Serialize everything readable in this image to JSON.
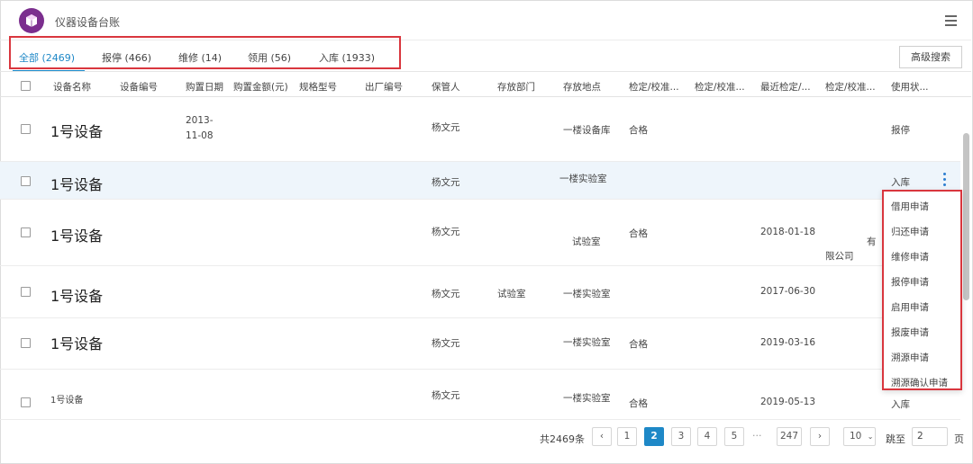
{
  "app": {
    "title": "仪器设备台账"
  },
  "tabs": [
    {
      "label": "全部 (2469)"
    },
    {
      "label": "报停 (466)"
    },
    {
      "label": "维修 (14)"
    },
    {
      "label": "领用 (56)"
    },
    {
      "label": "入库 (1933)"
    }
  ],
  "toolbar": {
    "advanced_search_label": "高级搜索"
  },
  "table": {
    "columns": [
      "设备名称",
      "设备编号",
      "购置日期",
      "购置金额(元)",
      "规格型号",
      "出厂编号",
      "保管人",
      "存放部门",
      "存放地点",
      "检定/校准...",
      "检定/校准...",
      "最近检定/...",
      "检定/校准...",
      "使用状..."
    ],
    "rows": [
      {
        "name": "1号设备",
        "date_line1": "2013-",
        "date_line2": "11-08",
        "keeper": "杨文元",
        "dept": "",
        "location": "一楼设备库",
        "calib_result": "合格",
        "recent_date": "",
        "extra": "",
        "status": "报停"
      },
      {
        "name": "1号设备",
        "date_line1": "",
        "date_line2": "",
        "keeper": "杨文元",
        "dept": "",
        "location": "一楼实验室",
        "calib_result": "",
        "recent_date": "",
        "extra": "",
        "status": "入库"
      },
      {
        "name": "1号设备",
        "date_line1": "",
        "date_line2": "",
        "keeper": "杨文元",
        "dept": "",
        "location": "试验室",
        "calib_result": "合格",
        "recent_date": "2018-01-18",
        "extra": "限公司",
        "extra2": "有",
        "status": ""
      },
      {
        "name": "1号设备",
        "date_line1": "",
        "date_line2": "",
        "keeper": "杨文元",
        "dept": "试验室",
        "location": "一楼实验室",
        "calib_result": "",
        "recent_date": "2017-06-30",
        "extra": "",
        "status": ""
      },
      {
        "name": "1号设备",
        "date_line1": "",
        "date_line2": "",
        "keeper": "杨文元",
        "dept": "",
        "location": "一楼实验室",
        "calib_result": "合格",
        "recent_date": "2019-03-16",
        "extra": "",
        "status": ""
      },
      {
        "name": "1号设备",
        "date_line1": "",
        "date_line2": "",
        "keeper": "杨文元",
        "dept": "",
        "location": "一楼实验室",
        "calib_result": "合格",
        "recent_date": "2019-05-13",
        "extra": "",
        "status": "入库"
      }
    ]
  },
  "context_menu": {
    "items": [
      "借用申请",
      "归还申请",
      "维修申请",
      "报停申请",
      "启用申请",
      "报废申请",
      "溯源申请",
      "溯源确认申请"
    ]
  },
  "pagination": {
    "total": "共2469条",
    "prev": "‹",
    "pages": [
      "1",
      "2",
      "3",
      "4",
      "5"
    ],
    "current": "2",
    "ellipsis": "···",
    "last": "247",
    "next": "›",
    "page_size": "10",
    "goto_label": "跳至",
    "goto_value": "2",
    "page_suffix": "页"
  }
}
